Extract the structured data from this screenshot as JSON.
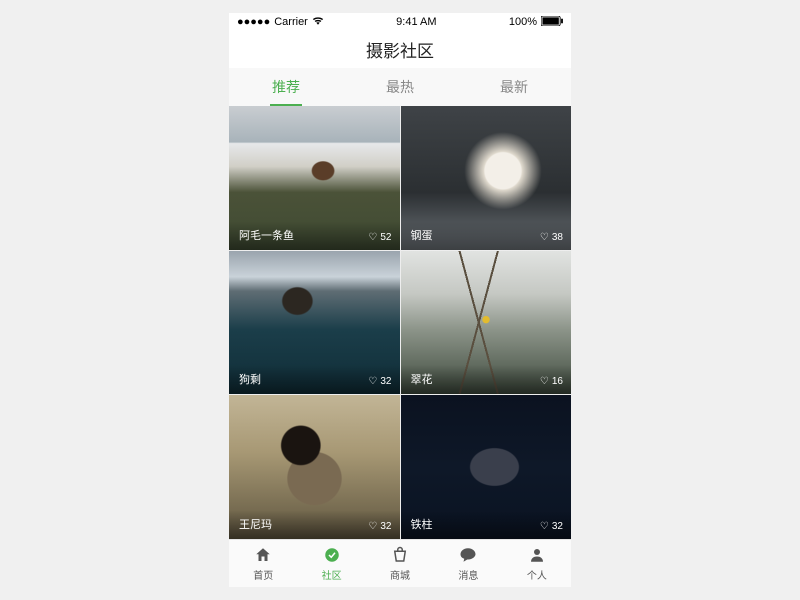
{
  "status": {
    "carrier": "Carrier",
    "time": "9:41 AM",
    "battery": "100%"
  },
  "title": "摄影社区",
  "tabs": [
    {
      "label": "推荐",
      "active": true
    },
    {
      "label": "最热",
      "active": false
    },
    {
      "label": "最新",
      "active": false
    }
  ],
  "photos": [
    {
      "user": "阿毛一条鱼",
      "likes": 52
    },
    {
      "user": "钢蛋",
      "likes": 38
    },
    {
      "user": "狗剩",
      "likes": 32
    },
    {
      "user": "翠花",
      "likes": 16
    },
    {
      "user": "王尼玛",
      "likes": 32
    },
    {
      "user": "铁柱",
      "likes": 32
    }
  ],
  "nav": [
    {
      "label": "首页",
      "icon": "home-icon"
    },
    {
      "label": "社区",
      "icon": "community-icon",
      "active": true
    },
    {
      "label": "商城",
      "icon": "store-icon"
    },
    {
      "label": "消息",
      "icon": "message-icon"
    },
    {
      "label": "个人",
      "icon": "profile-icon"
    }
  ]
}
